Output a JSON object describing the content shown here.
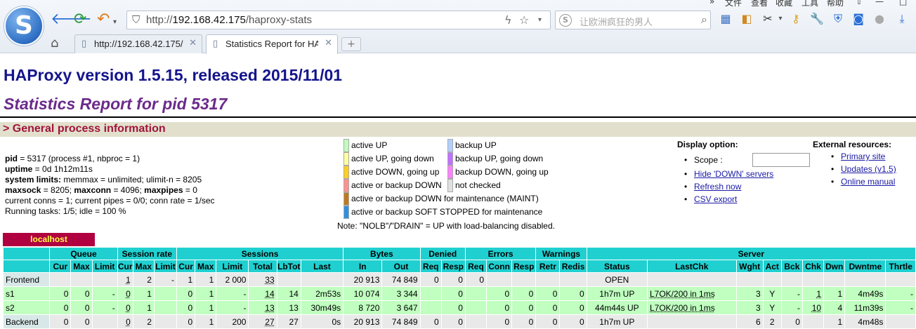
{
  "browser": {
    "url_prefix": "http://",
    "url_host": "192.168.42.175",
    "url_path": "/haproxy-stats",
    "search_placeholder": "让欧洲疯狂的男人",
    "menu": [
      "文件",
      "查看",
      "收藏",
      "工具",
      "帮助"
    ],
    "tabs": [
      {
        "title": "http://192.168.42.175/"
      },
      {
        "title": "Statistics Report for HA"
      }
    ]
  },
  "page": {
    "version_title": "HAProxy version 1.5.15, released 2015/11/01",
    "report_title": "Statistics Report for pid 5317",
    "section_title": "> General process information",
    "process_info": [
      {
        "b": "pid",
        "t": " = 5317 (process #1, nbproc = 1)"
      },
      {
        "b": "uptime",
        "t": " = 0d 1h12m11s"
      },
      {
        "b": "system limits:",
        "t": " memmax = unlimited; ulimit-n = 8205"
      },
      {
        "b": "maxsock",
        "t": " = 8205; ",
        "b2": "maxconn",
        "t2": " = 4096; ",
        "b3": "maxpipes",
        "t3": " = 0"
      },
      {
        "b": "",
        "t": "current conns = 1; current pipes = 0/0; conn rate = 1/sec"
      },
      {
        "b": "",
        "t": "Running tasks: 1/5; idle = 100 %"
      }
    ],
    "legend_left": [
      {
        "label": "active UP",
        "color": "#c0ffc0"
      },
      {
        "label": "active UP, going down",
        "color": "#ffffa0"
      },
      {
        "label": "active DOWN, going up",
        "color": "#ffd020"
      },
      {
        "label": "active or backup DOWN",
        "color": "#ff9090"
      },
      {
        "label": "active or backup DOWN for maintenance (MAINT)",
        "color": "#c07820"
      },
      {
        "label": "active or backup SOFT STOPPED for maintenance",
        "color": "#3090e0"
      }
    ],
    "legend_right": [
      {
        "label": "backup UP",
        "color": "#b0d0ff"
      },
      {
        "label": "backup UP, going down",
        "color": "#c070ff"
      },
      {
        "label": "backup DOWN, going up",
        "color": "#ff80ff"
      },
      {
        "label": "not checked",
        "color": "#e0e0e0"
      }
    ],
    "note": "Note: \"NOLB\"/\"DRAIN\" = UP with load-balancing disabled.",
    "display_option": {
      "heading": "Display option:",
      "scope_label": "Scope :",
      "links": [
        "Hide 'DOWN' servers",
        "Refresh now",
        "CSV export"
      ]
    },
    "external": {
      "heading": "External resources:",
      "links": [
        "Primary site",
        "Updates (v1.5)",
        "Online manual"
      ]
    },
    "proxy_name": "localhost"
  },
  "table": {
    "groups": [
      {
        "label": "",
        "span": 1
      },
      {
        "label": "Queue",
        "span": 3
      },
      {
        "label": "Session rate",
        "span": 3
      },
      {
        "label": "Sessions",
        "span": 6
      },
      {
        "label": "Bytes",
        "span": 2
      },
      {
        "label": "Denied",
        "span": 2
      },
      {
        "label": "Errors",
        "span": 3
      },
      {
        "label": "Warnings",
        "span": 2
      },
      {
        "label": "Server",
        "span": 9
      }
    ],
    "columns": [
      "",
      "Cur",
      "Max",
      "Limit",
      "Cur",
      "Max",
      "Limit",
      "Cur",
      "Max",
      "Limit",
      "Total",
      "LbTot",
      "Last",
      "In",
      "Out",
      "Req",
      "Resp",
      "Req",
      "Conn",
      "Resp",
      "Retr",
      "Redis",
      "Status",
      "LastChk",
      "Wght",
      "Act",
      "Bck",
      "Chk",
      "Dwn",
      "Dwntme",
      "Thrtle"
    ],
    "rows": [
      {
        "kind": "fe",
        "cells": [
          "Frontend",
          "",
          "",
          "",
          "1",
          "2",
          "-",
          "1",
          "1",
          "2 000",
          "33",
          "",
          "",
          "20 913",
          "74 849",
          "0",
          "0",
          "0",
          "",
          "",
          "",
          "",
          "OPEN",
          "",
          "",
          "",
          "",
          "",
          "",
          "",
          ""
        ]
      },
      {
        "kind": "up",
        "cells": [
          "s1",
          "0",
          "0",
          "-",
          "0",
          "1",
          "",
          "0",
          "1",
          "-",
          "14",
          "14",
          "2m53s",
          "10 074",
          "3 344",
          "",
          "0",
          "",
          "0",
          "0",
          "0",
          "0",
          "1h7m UP",
          "L7OK/200 in 1ms",
          "3",
          "Y",
          "-",
          "1",
          "1",
          "4m49s",
          "-"
        ]
      },
      {
        "kind": "up",
        "cells": [
          "s2",
          "0",
          "0",
          "-",
          "0",
          "1",
          "",
          "0",
          "1",
          "-",
          "13",
          "13",
          "30m49s",
          "8 720",
          "3 647",
          "",
          "0",
          "",
          "0",
          "0",
          "0",
          "0",
          "44m44s UP",
          "L7OK/200 in 1ms",
          "3",
          "Y",
          "-",
          "10",
          "4",
          "11m39s",
          "-"
        ]
      },
      {
        "kind": "be",
        "cells": [
          "Backend",
          "0",
          "0",
          "",
          "0",
          "2",
          "",
          "0",
          "1",
          "200",
          "27",
          "27",
          "0s",
          "20 913",
          "74 849",
          "0",
          "0",
          "",
          "0",
          "0",
          "0",
          "0",
          "1h7m UP",
          "",
          "6",
          "2",
          "0",
          "",
          "1",
          "4m48s",
          ""
        ]
      }
    ]
  }
}
